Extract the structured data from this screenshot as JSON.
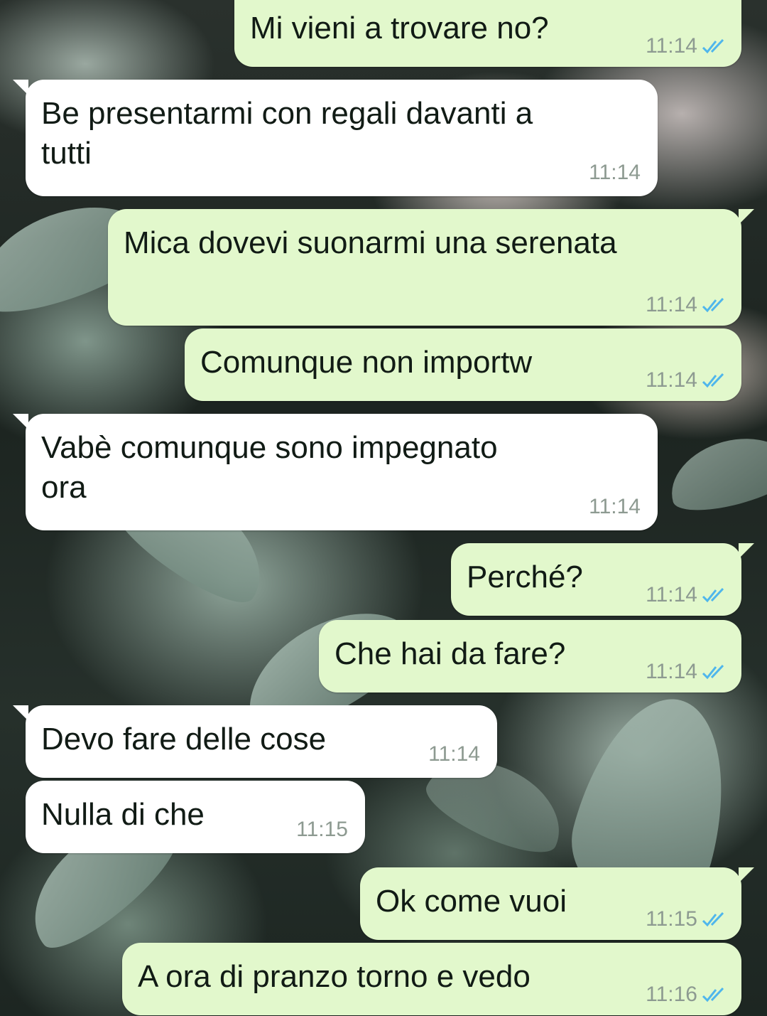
{
  "colors": {
    "outgoing_bubble": "#e2f8cc",
    "incoming_bubble": "#ffffff",
    "read_ticks": "#4fb6ec",
    "timestamp": "#8d9a91"
  },
  "icons": {
    "read_receipt": "double-check-icon"
  },
  "messages": [
    {
      "direction": "out",
      "text": "Mi vieni a trovare no?",
      "time": "11:14",
      "read": true
    },
    {
      "direction": "in",
      "text": "Be presentarmi con regali davanti a\ntutti",
      "time": "11:14"
    },
    {
      "direction": "out",
      "text": "Mica dovevi suonarmi una serenata",
      "time": "11:14",
      "read": true
    },
    {
      "direction": "out",
      "text": "Comunque non importw",
      "time": "11:14",
      "read": true
    },
    {
      "direction": "in",
      "text": "Vabè comunque sono impegnato\nora",
      "time": "11:14"
    },
    {
      "direction": "out",
      "text": "Perché?",
      "time": "11:14",
      "read": true
    },
    {
      "direction": "out",
      "text": "Che hai da fare?",
      "time": "11:14",
      "read": true
    },
    {
      "direction": "in",
      "text": "Devo fare delle cose",
      "time": "11:14"
    },
    {
      "direction": "in",
      "text": "Nulla di che",
      "time": "11:15"
    },
    {
      "direction": "out",
      "text": "Ok come vuoi",
      "time": "11:15",
      "read": true
    },
    {
      "direction": "out",
      "text": "A ora di pranzo torno e vedo",
      "time": "11:16",
      "read": true
    }
  ]
}
